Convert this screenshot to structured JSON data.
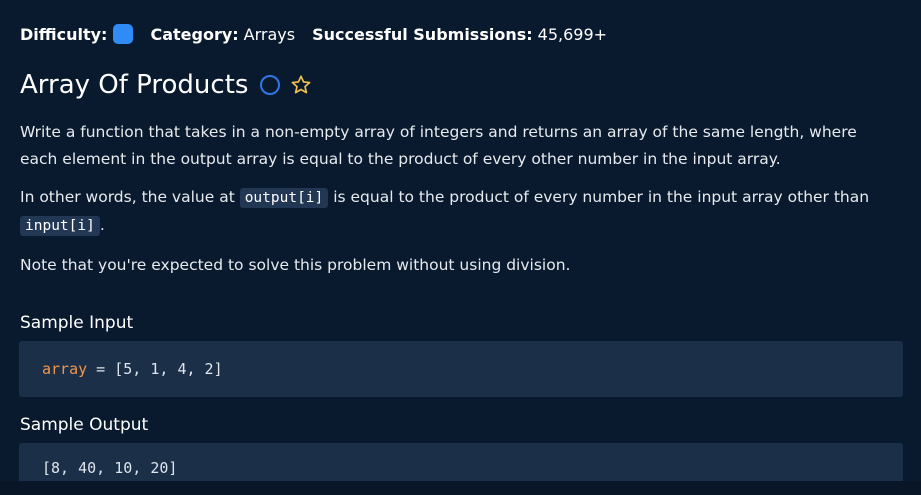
{
  "meta": {
    "difficulty_label": "Difficulty:",
    "category_label": "Category:",
    "category_value": "Arrays",
    "submissions_label": "Successful Submissions:",
    "submissions_value": "45,699+",
    "difficulty_color": "#2f8cf5"
  },
  "problem": {
    "title": "Array Of Products",
    "icons": [
      "completion-circle-icon",
      "star-icon"
    ]
  },
  "description": {
    "p1": "Write a function that takes in a non-empty array of integers and returns an array of the same length, where each element in the output array is equal to the product of every other number in the input array.",
    "p2_before": "In other words, the value at ",
    "p2_code1": "output[i]",
    "p2_middle": " is equal to the product of every number in the input array other than ",
    "p2_code2": "input[i]",
    "p2_after": ".",
    "p3": "Note that you're expected to solve this problem without using division."
  },
  "sample_input": {
    "heading": "Sample Input",
    "var_name": "array",
    "rest": " = [5, 1, 4, 2]"
  },
  "sample_output": {
    "heading": "Sample Output",
    "value": "[8, 40, 10, 20]"
  },
  "colors": {
    "background": "#0a1a2e",
    "code_background": "#1c2f49",
    "keyword": "#f0964a",
    "accent_blue": "#2f77e6",
    "star": "#f2c14e"
  }
}
